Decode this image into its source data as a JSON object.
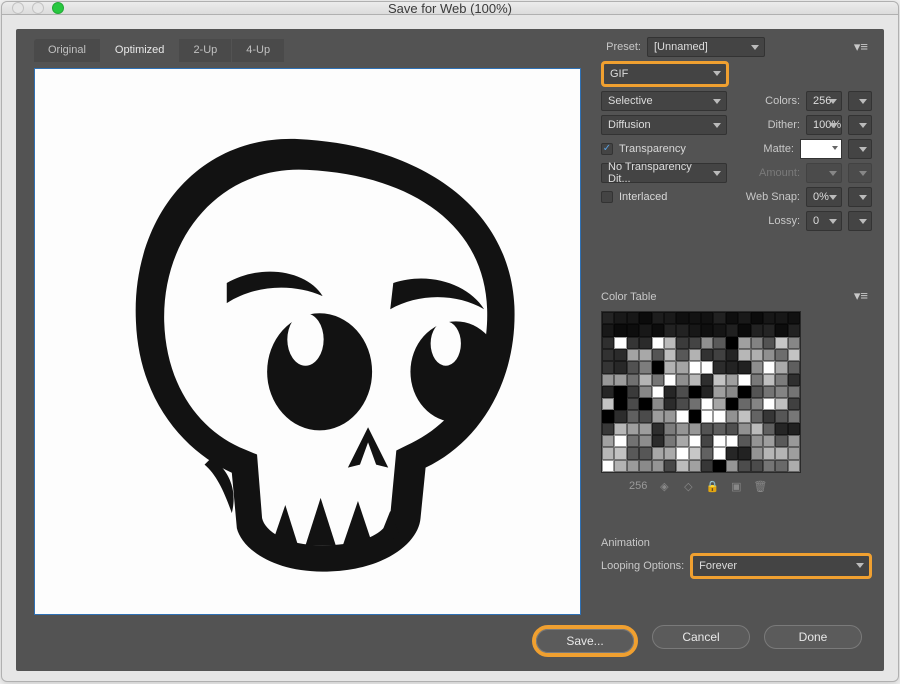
{
  "window": {
    "title": "Save for Web (100%)"
  },
  "tabs": {
    "original": "Original",
    "optimized": "Optimized",
    "twoup": "2-Up",
    "fourup": "4-Up",
    "active": "Optimized"
  },
  "preset": {
    "label": "Preset:",
    "value": "[Unnamed]"
  },
  "format": {
    "value": "GIF"
  },
  "reduction": {
    "value": "Selective"
  },
  "colors": {
    "label": "Colors:",
    "value": "256"
  },
  "dither_algo": {
    "value": "Diffusion"
  },
  "dither": {
    "label": "Dither:",
    "value": "100%"
  },
  "transparency": {
    "label": "Transparency",
    "checked": true
  },
  "matte": {
    "label": "Matte:",
    "value": "#ffffff"
  },
  "trans_dither": {
    "value": "No Transparency Dit..."
  },
  "amount": {
    "label": "Amount:",
    "value": ""
  },
  "interlaced": {
    "label": "Interlaced",
    "checked": false
  },
  "websnap": {
    "label": "Web Snap:",
    "value": "0%"
  },
  "lossy": {
    "label": "Lossy:",
    "value": "0"
  },
  "colortable": {
    "title": "Color Table",
    "count": "256"
  },
  "animation": {
    "title": "Animation",
    "looping_label": "Looping Options:",
    "looping_value": "Forever"
  },
  "buttons": {
    "save": "Save...",
    "cancel": "Cancel",
    "done": "Done"
  }
}
